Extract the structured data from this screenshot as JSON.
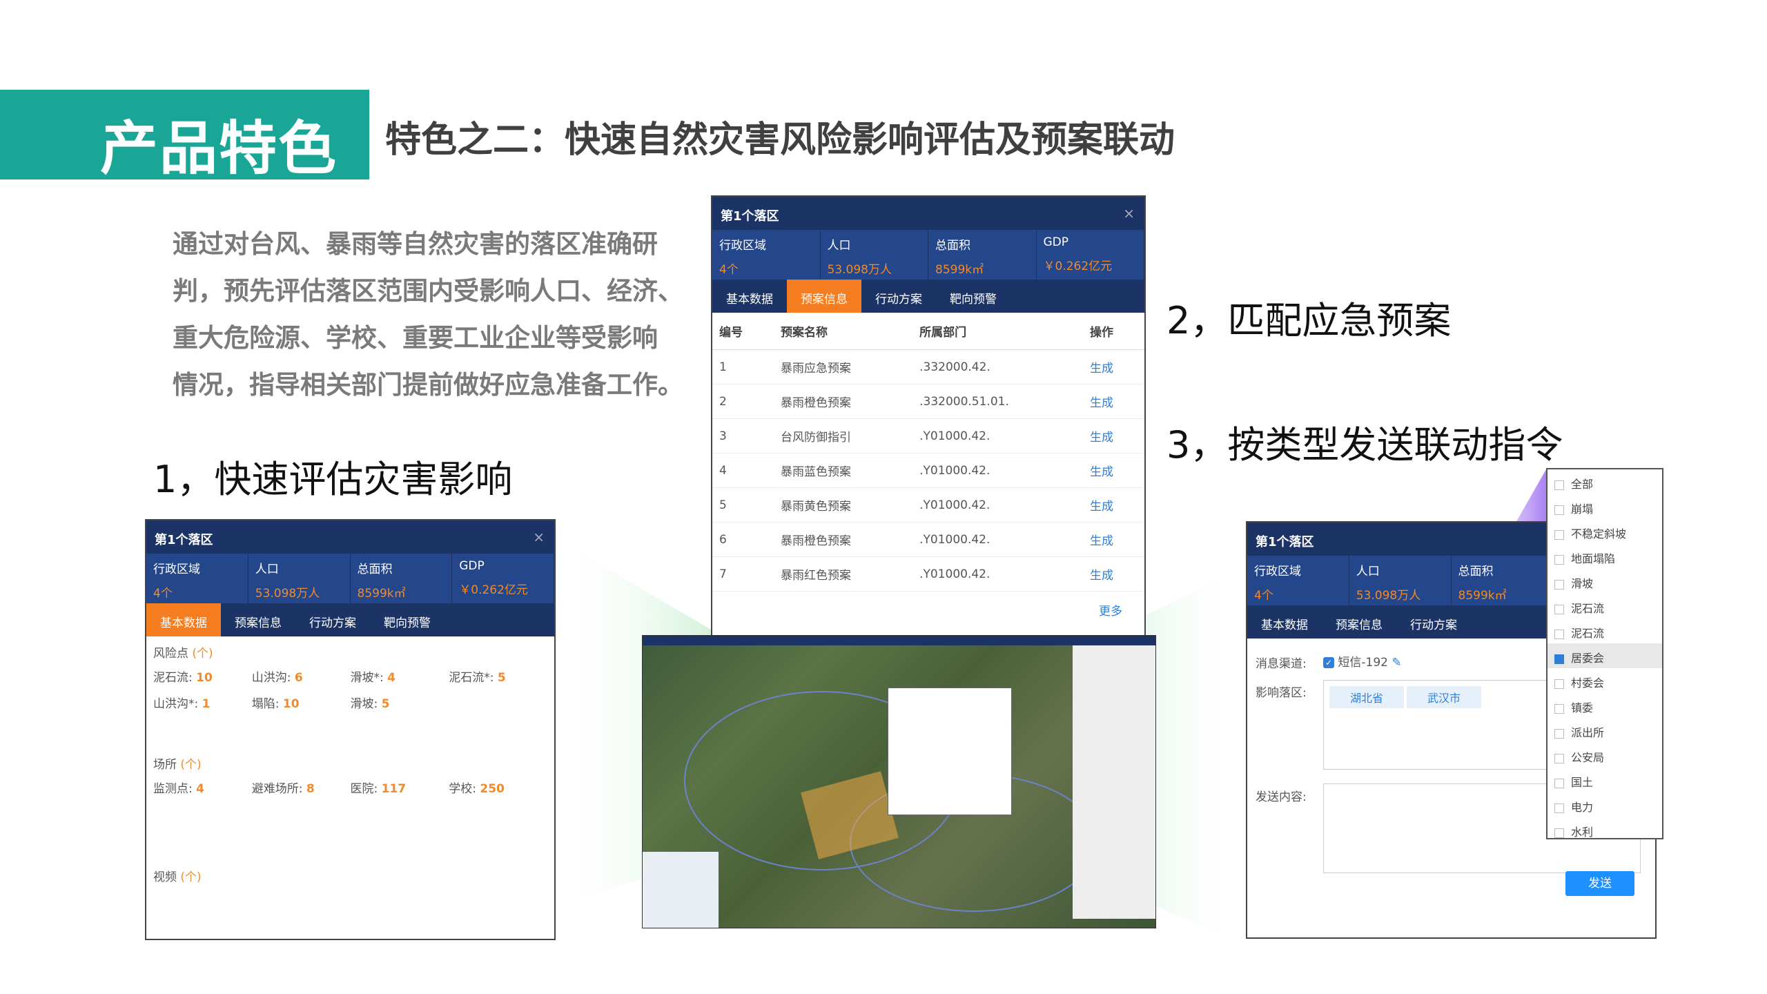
{
  "header": {
    "title": "产品特色",
    "subtitle": "特色之二：快速自然灾害风险影响评估及预案联动"
  },
  "intro": [
    "通过对台风、暴雨等自然灾害的落区准确研",
    "判，预先评估落区范围内受影响人口、经济、",
    "重大危险源、学校、重要工业企业等受影响",
    "情况，指导相关部门提前做好应急准备工作。"
  ],
  "steps": {
    "s1": "1，快速评估灾害影响",
    "s2": "2，匹配应急预案",
    "s3": "3，按类型发送联动指令"
  },
  "panel": {
    "title": "第1个落区",
    "close": "×",
    "stats": [
      {
        "label": "行政区域",
        "value": "4个"
      },
      {
        "label": "人口",
        "value": "53.098万人"
      },
      {
        "label": "总面积",
        "value": "8599k㎡"
      },
      {
        "label": "GDP",
        "value": "￥0.262亿元"
      }
    ],
    "tabs": [
      "基本数据",
      "预案信息",
      "行动方案",
      "靶向预警"
    ]
  },
  "basic": {
    "risk_label": "风险点",
    "unit": "(个)",
    "risk": [
      {
        "k": "泥石流:",
        "v": "10"
      },
      {
        "k": "山洪沟:",
        "v": "6"
      },
      {
        "k": "滑坡*:",
        "v": "4"
      },
      {
        "k": "泥石流*:",
        "v": "5"
      },
      {
        "k": "山洪沟*:",
        "v": "1"
      },
      {
        "k": "塌陷:",
        "v": "10"
      },
      {
        "k": "滑坡:",
        "v": "5"
      }
    ],
    "place_label": "场所",
    "place": [
      {
        "k": "监测点:",
        "v": "4"
      },
      {
        "k": "避难场所:",
        "v": "8"
      },
      {
        "k": "医院:",
        "v": "117"
      },
      {
        "k": "学校:",
        "v": "250"
      }
    ],
    "video_label": "视频"
  },
  "plans": {
    "headers": [
      "编号",
      "预案名称",
      "所属部门",
      "操作"
    ],
    "rows": [
      [
        "1",
        "暴雨应急预案",
        ".332000.42.",
        "生成"
      ],
      [
        "2",
        "暴雨橙色预案",
        ".332000.51.01.",
        "生成"
      ],
      [
        "3",
        "台风防御指引",
        ".Y01000.42.",
        "生成"
      ],
      [
        "4",
        "暴雨蓝色预案",
        ".Y01000.42.",
        "生成"
      ],
      [
        "5",
        "暴雨黄色预案",
        ".Y01000.42.",
        "生成"
      ],
      [
        "6",
        "暴雨橙色预案",
        ".Y01000.42.",
        "生成"
      ],
      [
        "7",
        "暴雨红色预案",
        ".Y01000.42.",
        "生成"
      ]
    ],
    "more": "更多"
  },
  "form": {
    "channel_label": "消息渠道:",
    "channel": "短信-192",
    "area_label": "影响落区:",
    "areas": [
      "湖北省",
      "武汉市"
    ],
    "content_label": "发送内容:",
    "send": "发送"
  },
  "dropdown": {
    "options": [
      "全部",
      "崩塌",
      "不稳定斜坡",
      "地面塌陷",
      "滑坡",
      "泥石流",
      "泥石流",
      "居委会",
      "村委会",
      "镇委",
      "派出所",
      "公安局",
      "国土",
      "电力",
      "水利"
    ],
    "selected": 7
  },
  "colors": {
    "teal": "#1aa697",
    "navy": "#1c3366",
    "orange": "#f57c1f",
    "green": "#5ccf78",
    "purple": "#9b6bf0"
  }
}
